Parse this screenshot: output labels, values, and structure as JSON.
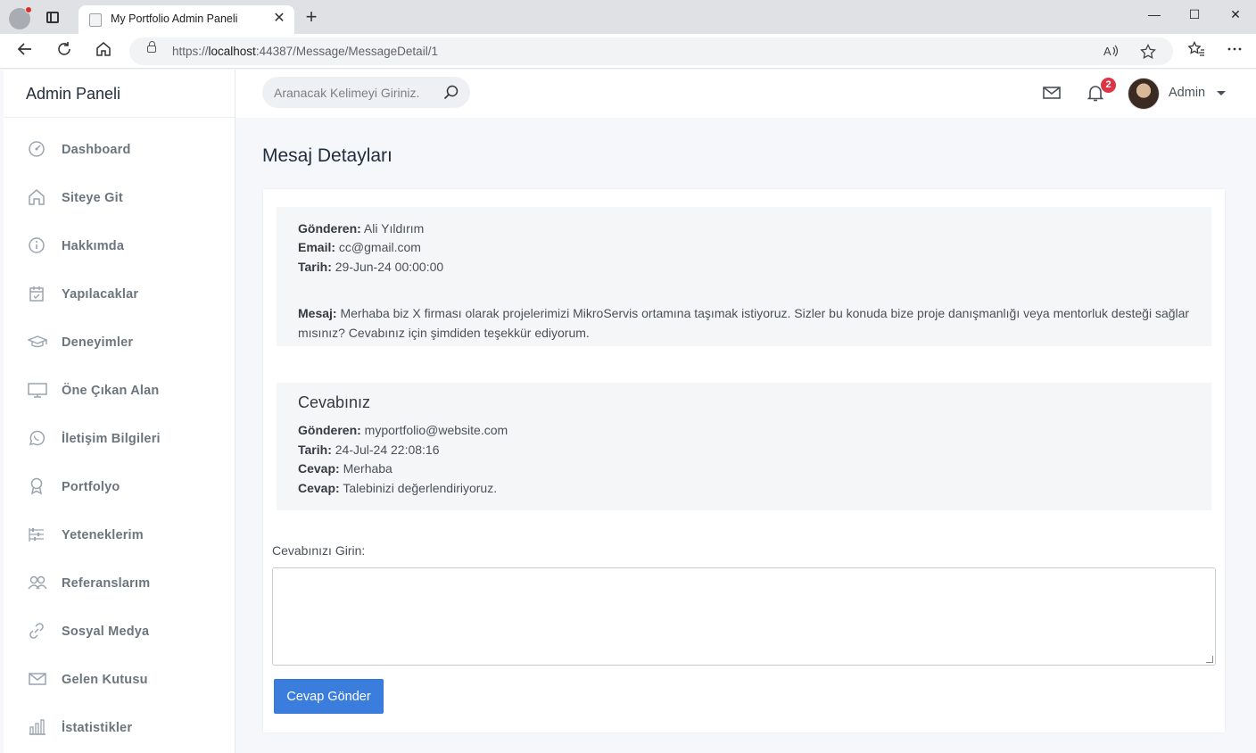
{
  "browser": {
    "tab_title": "My Portfolio Admin Paneli",
    "tab_close": "✕",
    "new_tab": "+",
    "url_scheme": "https://",
    "url_host": "localhost",
    "url_rest": ":44387/Message/MessageDetail/1",
    "window_controls": {
      "minimize": "—",
      "maximize": "☐",
      "close": "✕"
    }
  },
  "sidebar": {
    "brand": "Admin Paneli",
    "items": [
      {
        "label": "Dashboard",
        "icon": "speedometer-icon"
      },
      {
        "label": "Siteye Git",
        "icon": "home-icon"
      },
      {
        "label": "Hakkımda",
        "icon": "info-icon"
      },
      {
        "label": "Yapılacaklar",
        "icon": "calendar-check-icon"
      },
      {
        "label": "Deneyimler",
        "icon": "graduation-cap-icon"
      },
      {
        "label": "Öne Çıkan Alan",
        "icon": "monitor-icon"
      },
      {
        "label": "İletişim Bilgileri",
        "icon": "whatsapp-icon"
      },
      {
        "label": "Portfolyo",
        "icon": "award-icon"
      },
      {
        "label": "Yeteneklerim",
        "icon": "sliders-icon"
      },
      {
        "label": "Referanslarım",
        "icon": "users-icon"
      },
      {
        "label": "Sosyal Medya",
        "icon": "link-icon"
      },
      {
        "label": "Gelen Kutusu",
        "icon": "mail-icon"
      },
      {
        "label": "İstatistikler",
        "icon": "bar-chart-icon"
      }
    ]
  },
  "navbar": {
    "search_placeholder": "Aranacak Kelimeyi Giriniz.",
    "notification_count": "2",
    "user_name": "Admin"
  },
  "page": {
    "title": "Mesaj Detayları"
  },
  "message": {
    "sender_label": "Gönderen:",
    "sender": "Ali Yıldırım",
    "email_label": "Email:",
    "email": "cc@gmail.com",
    "date_label": "Tarih:",
    "date": "29-Jun-24 00:00:00",
    "body_label": "Mesaj:",
    "body": "Merhaba biz X firması olarak projelerimizi MikroServis ortamına taşımak istiyoruz. Sizler bu konuda bize proje danışmanlığı veya mentorluk desteği sağlar mısınız? Cevabınız için şimdiden teşekkür ediyorum."
  },
  "reply": {
    "title": "Cevabınız",
    "sender_label": "Gönderen:",
    "sender": "myportfolio@website.com",
    "date_label": "Tarih:",
    "date": "24-Jul-24 22:08:16",
    "answer_label": "Cevap:",
    "answer": "Merhaba",
    "answer2_label": "Cevap:",
    "answer2": "Talebinizi değerlendiriyoruz."
  },
  "form": {
    "input_label": "Cevabınızı Girin:",
    "input_value": "",
    "submit_label": "Cevap Gönder"
  },
  "colors": {
    "primary": "#3b7ddd",
    "badge": "#dc3545",
    "background": "#f5f7fb"
  }
}
